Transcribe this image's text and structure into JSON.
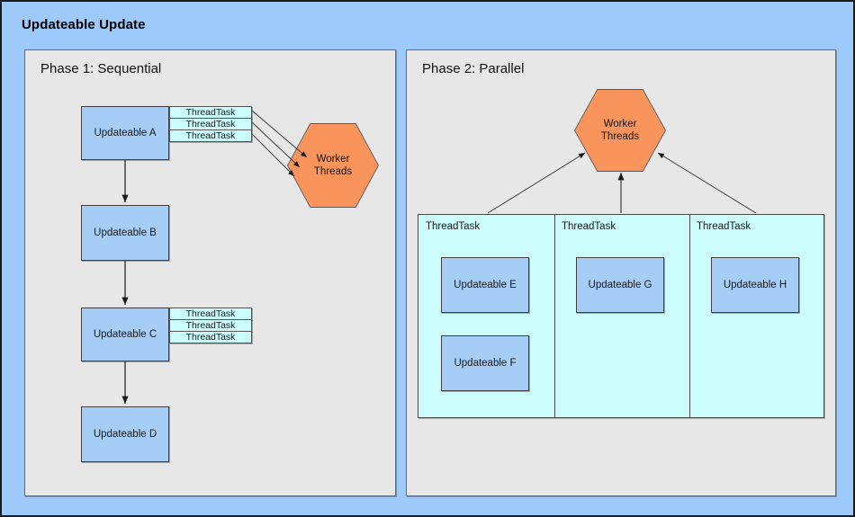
{
  "diagram": {
    "title": "Updateable Update",
    "background_color": "#9ec9fb",
    "panel_color": "#e7e7e7",
    "updateable_color": "#a5cdf5",
    "threadtask_color": "#ccfcfc",
    "worker_color": "#f9945c"
  },
  "phase1": {
    "label": "Phase 1: Sequential",
    "worker": {
      "line1": "Worker",
      "line2": "Threads"
    },
    "nodes": [
      {
        "label": "Updateable A"
      },
      {
        "label": "Updateable B"
      },
      {
        "label": "Updateable C"
      },
      {
        "label": "Updateable D"
      }
    ],
    "threadtasks_a": [
      {
        "label": "ThreadTask"
      },
      {
        "label": "ThreadTask"
      },
      {
        "label": "ThreadTask"
      }
    ],
    "threadtasks_c": [
      {
        "label": "ThreadTask"
      },
      {
        "label": "ThreadTask"
      },
      {
        "label": "ThreadTask"
      }
    ]
  },
  "phase2": {
    "label": "Phase 2: Parallel",
    "worker": {
      "line1": "Worker",
      "line2": "Threads"
    },
    "columns": [
      {
        "label": "ThreadTask",
        "nodes": [
          {
            "label": "Updateable E"
          },
          {
            "label": "Updateable F"
          }
        ]
      },
      {
        "label": "ThreadTask",
        "nodes": [
          {
            "label": "Updateable G"
          }
        ]
      },
      {
        "label": "ThreadTask",
        "nodes": [
          {
            "label": "Updateable H"
          }
        ]
      }
    ]
  }
}
